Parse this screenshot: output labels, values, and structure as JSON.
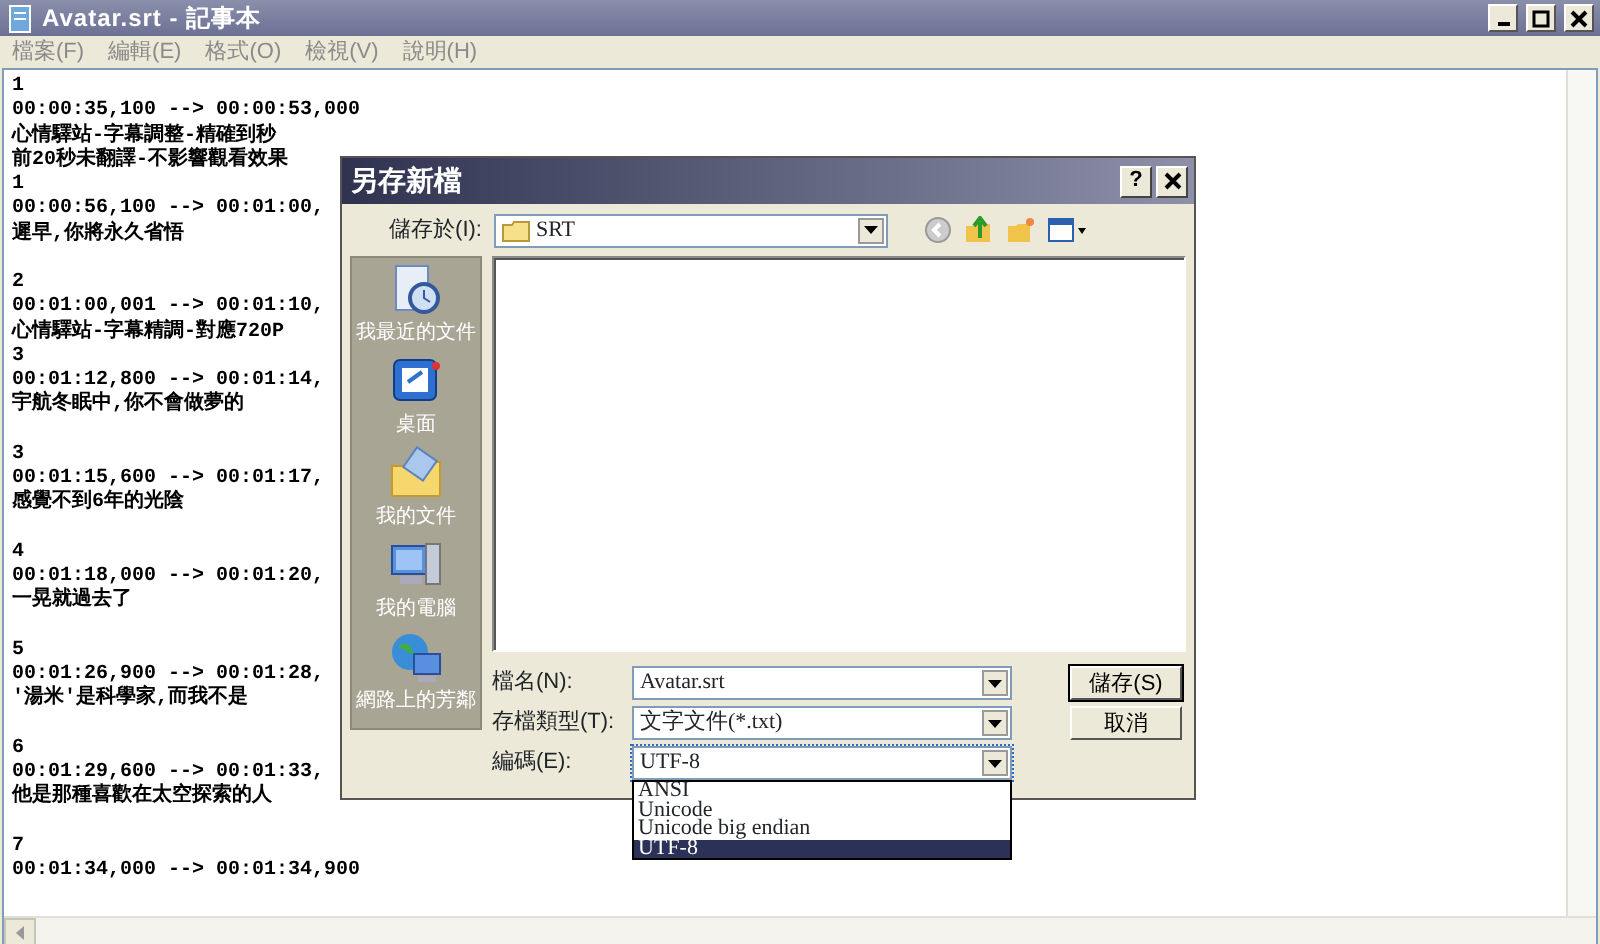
{
  "window": {
    "title": "Avatar.srt - 記事本"
  },
  "menu": [
    "檔案(F)",
    "編輯(E)",
    "格式(O)",
    "檢視(V)",
    "說明(H)"
  ],
  "editor": {
    "blocks": [
      [
        "1",
        "00:00:35,100 --> 00:00:53,000",
        "心情驛站-字幕調整-精確到秒",
        "前20秒未翻譯-不影響觀看效果",
        "1",
        "00:00:56,100 --> 00:01:00,",
        "遲早,你將永久省悟"
      ],
      [
        "2",
        "00:01:00,001 --> 00:01:10,",
        "心情驛站-字幕精調-對應720P",
        "3",
        "00:01:12,800 --> 00:01:14,",
        "宇航冬眠中,你不會做夢的"
      ],
      [
        "3",
        "00:01:15,600 --> 00:01:17,",
        "感覺不到6年的光陰"
      ],
      [
        "4",
        "00:01:18,000 --> 00:01:20,",
        "一晃就過去了"
      ],
      [
        "5",
        "00:01:26,900 --> 00:01:28,",
        "'湯米'是科學家,而我不是"
      ],
      [
        "6",
        "00:01:29,600 --> 00:01:33,",
        "他是那種喜歡在太空探索的人"
      ],
      [
        "7",
        "00:01:34,000 --> 00:01:34,900"
      ]
    ]
  },
  "dialog": {
    "title": "另存新檔",
    "help": "?",
    "save_in": {
      "label": "儲存於(I):",
      "value": "SRT"
    },
    "places": [
      {
        "label": "我最近的文件",
        "kind": "recent"
      },
      {
        "label": "桌面",
        "kind": "desktop"
      },
      {
        "label": "我的文件",
        "kind": "documents"
      },
      {
        "label": "我的電腦",
        "kind": "computer"
      },
      {
        "label": "網路上的芳鄰",
        "kind": "network"
      }
    ],
    "fields": [
      {
        "label": "檔名(N):",
        "value": "Avatar.srt",
        "expanded": false
      },
      {
        "label": "存檔類型(T):",
        "value": "文字文件(*.txt)",
        "expanded": false
      },
      {
        "label": "編碼(E):",
        "value": "UTF-8",
        "expanded": true,
        "options": [
          {
            "label": "ANSI",
            "selected": false
          },
          {
            "label": "Unicode",
            "selected": false
          },
          {
            "label": "Unicode big endian",
            "selected": false
          },
          {
            "label": "UTF-8",
            "selected": true
          }
        ]
      }
    ],
    "buttons": [
      {
        "label": "儲存(S)",
        "default": true
      },
      {
        "label": "取消",
        "default": false
      }
    ]
  }
}
